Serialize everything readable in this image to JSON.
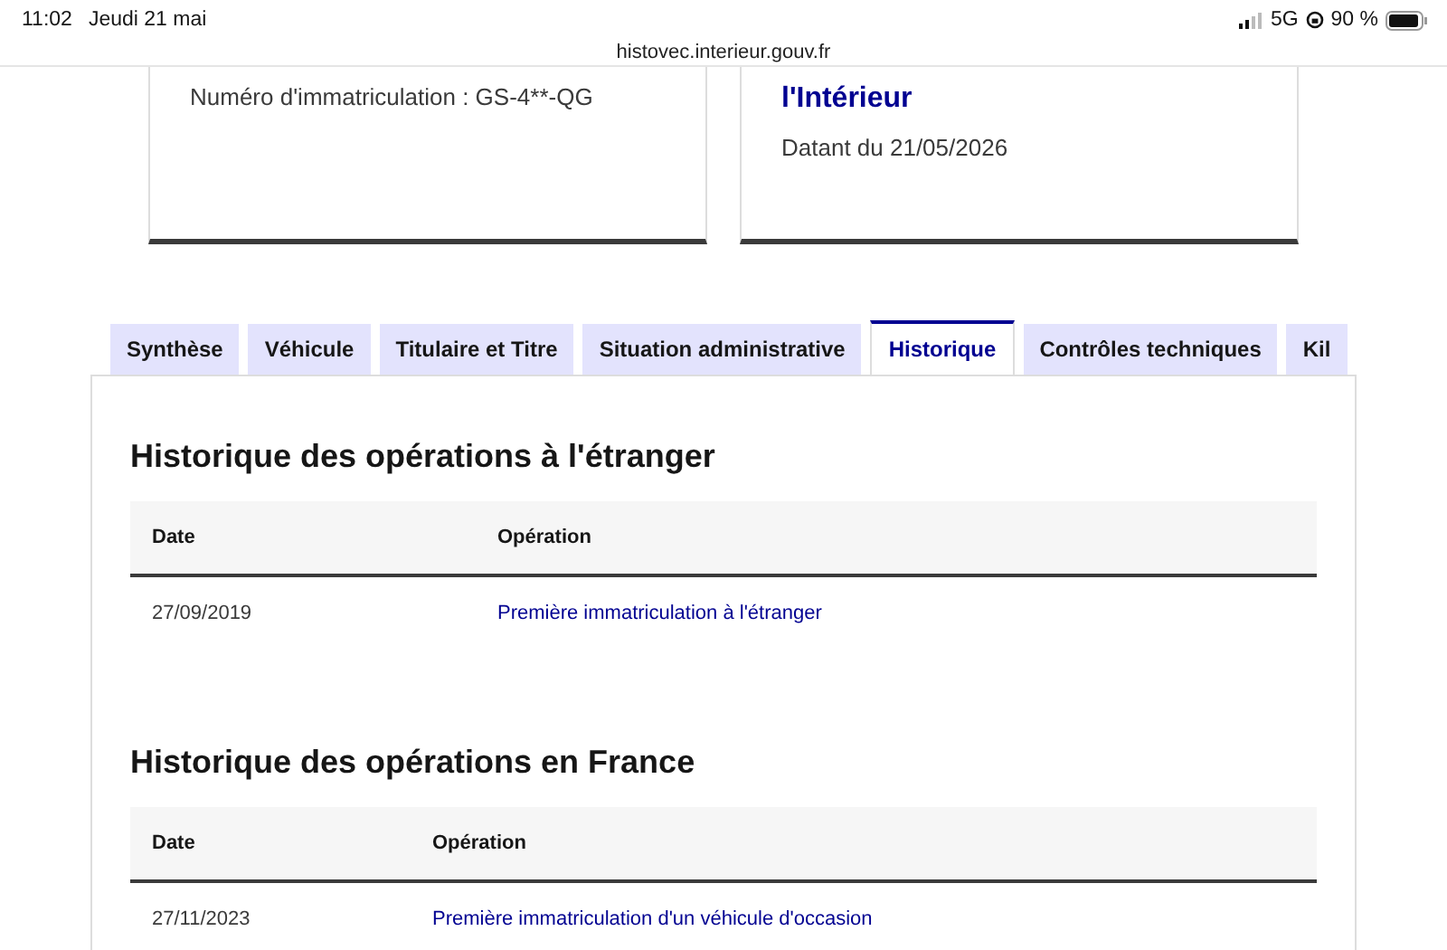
{
  "status_bar": {
    "time": "11:02",
    "date": "Jeudi 21 mai",
    "network": "5G",
    "battery": "90 %",
    "url": "histovec.interieur.gouv.fr"
  },
  "cards": [
    {
      "lines": [
        {
          "kind": "text",
          "text": "Numéro d'immatriculation : GS-4**-QG"
        }
      ]
    },
    {
      "lines": [
        {
          "kind": "heading",
          "text": "l'Intérieur"
        },
        {
          "kind": "text",
          "text": "Datant du 21/05/2026"
        }
      ]
    }
  ],
  "tabs": [
    {
      "label": "Synthèse",
      "selected": false
    },
    {
      "label": "Véhicule",
      "selected": false
    },
    {
      "label": "Titulaire et Titre",
      "selected": false
    },
    {
      "label": "Situation administrative",
      "selected": false
    },
    {
      "label": "Historique",
      "selected": true
    },
    {
      "label": "Contrôles techniques",
      "selected": false
    },
    {
      "label": "Kil",
      "selected": false
    }
  ],
  "sections": [
    {
      "title": "Historique des opérations à l'étranger",
      "columns": [
        "Date",
        "Opération"
      ],
      "rows": [
        [
          "27/09/2019",
          "Première immatriculation à l'étranger"
        ]
      ]
    },
    {
      "title": "Historique des opérations en France",
      "columns": [
        "Date",
        "Opération"
      ],
      "rows": [
        [
          "27/11/2023",
          "Première immatriculation d'un véhicule d'occasion"
        ]
      ]
    }
  ]
}
